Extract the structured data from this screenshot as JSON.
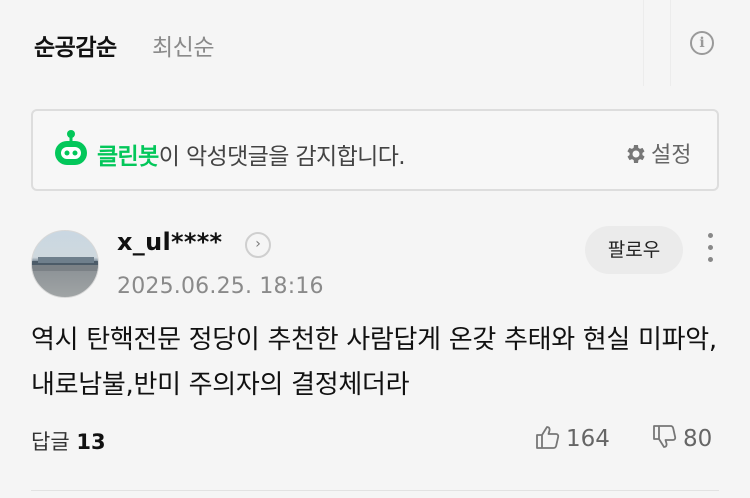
{
  "sort": {
    "active_label": "순공감순",
    "inactive_label": "최신순",
    "info_icon": "info-icon"
  },
  "cleanbot": {
    "icon": "robot-icon",
    "name": "클린봇",
    "message": "이 악성댓글을 감지합니다.",
    "settings_icon": "gear-icon",
    "settings_label": "설정",
    "accent_color": "#03c75a"
  },
  "comment": {
    "author": "x_ul****",
    "timestamp": "2025.06.25. 18:16",
    "follow_label": "팔로우",
    "text": "역시 탄핵전문 정당이 추천한 사람답게 온갖 추태와 현실 미파악,내로남불,반미 주의자의 결정체더라",
    "reply_label": "답글",
    "reply_count": "13",
    "like_count": "164",
    "dislike_count": "80"
  }
}
